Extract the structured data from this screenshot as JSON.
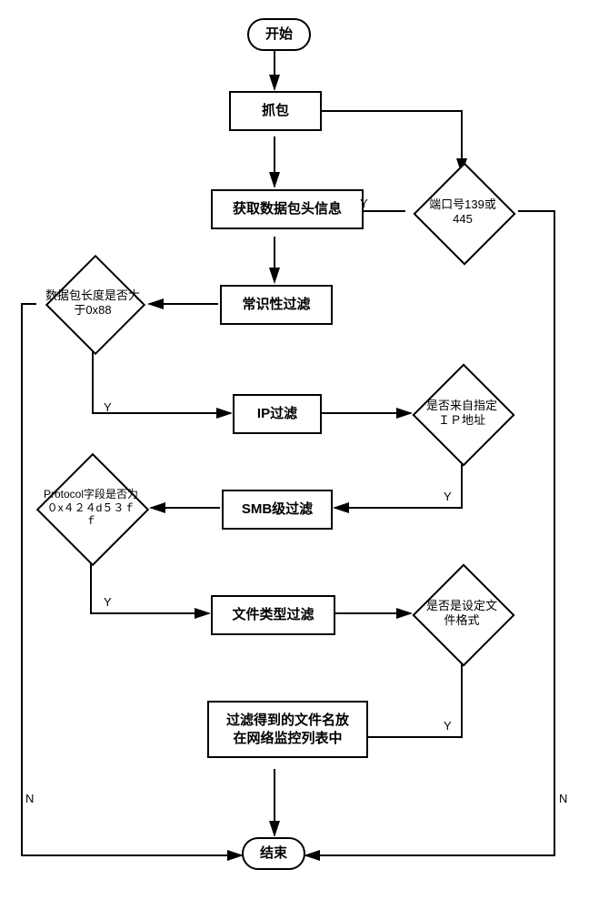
{
  "flowchart": {
    "start": "开始",
    "end": "结束",
    "process": {
      "capture": "抓包",
      "header": "获取数据包头信息",
      "common_filter": "常识性过滤",
      "ip_filter": "IP过滤",
      "smb_filter": "SMB级过滤",
      "filetype_filter": "文件类型过滤",
      "result": "过滤得到的文件名放在网络监控列表中"
    },
    "decision": {
      "port": "端口号139或445",
      "length": "数据包长度是否大于0x88",
      "ip": "是否来自指定ＩＰ地址",
      "protocol": "Protocol字段是否为０x４２４d５３ｆｆ",
      "format": "是否是设定文件格式"
    },
    "labels": {
      "yes": "Y",
      "no": "N"
    }
  }
}
